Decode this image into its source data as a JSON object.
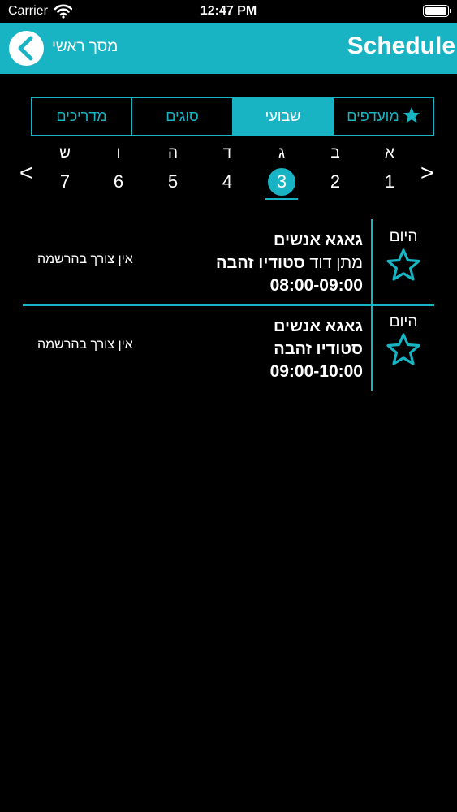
{
  "status": {
    "carrier": "Carrier",
    "time": "12:47 PM"
  },
  "nav": {
    "back_label": "מסך ראשי",
    "title": "Schedule"
  },
  "tabs": {
    "favorites": "מועדפים",
    "weekly": "שבועי",
    "types": "סוגים",
    "instructors": "מדריכים",
    "active": "weekly"
  },
  "week": {
    "days": [
      {
        "letter": "א",
        "num": "1"
      },
      {
        "letter": "ב",
        "num": "2"
      },
      {
        "letter": "ג",
        "num": "3"
      },
      {
        "letter": "ד",
        "num": "4"
      },
      {
        "letter": "ה",
        "num": "5"
      },
      {
        "letter": "ו",
        "num": "6"
      },
      {
        "letter": "ש",
        "num": "7"
      }
    ],
    "selected_index": 2,
    "prev": "<",
    "next": ">"
  },
  "classes": [
    {
      "day_label": "היום",
      "name": "גאגא אנשים",
      "instructor": "מתן דוד",
      "location": "סטודיו זהבה",
      "time": "08:00-09:00",
      "note": "אין צורך בהרשמה"
    },
    {
      "day_label": "היום",
      "name": "גאגא אנשים",
      "instructor": "",
      "location": "סטודיו זהבה",
      "time": "09:00-10:00",
      "note": "אין צורך בהרשמה"
    }
  ],
  "colors": {
    "accent": "#19b4c4",
    "background": "#000000"
  }
}
